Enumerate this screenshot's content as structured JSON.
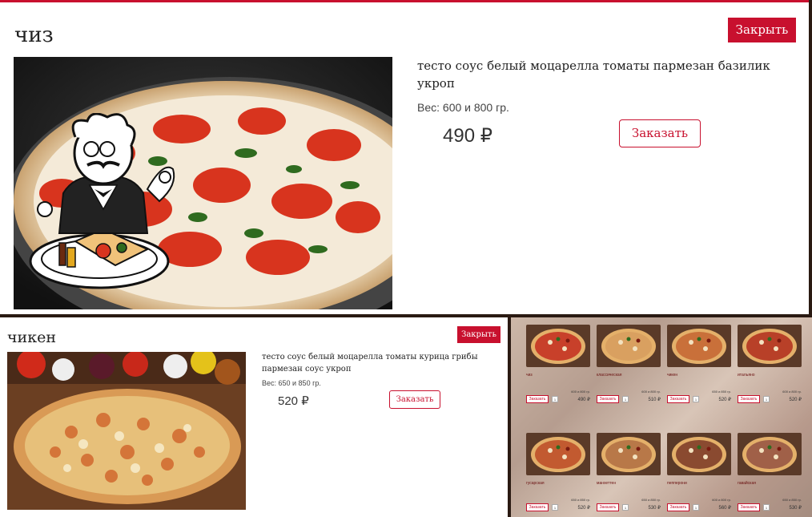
{
  "modal_top": {
    "title": "чиз",
    "close_label": "Закрыть",
    "description": "тесто соус белый моцарелла томаты пармезан базилик укроп",
    "weight": "Вес: 600 и 800 гр.",
    "price": "490 ₽",
    "order_label": "Заказать"
  },
  "modal_second": {
    "title": "чикен",
    "close_label": "Закрыть",
    "description": "тесто соус белый моцарелла томаты курица грибы пармезан соус укроп",
    "weight": "Вес: 650 и 850 гр.",
    "price": "520 ₽",
    "order_label": "Заказать"
  },
  "catalog": {
    "items": [
      {
        "name": "чиз",
        "weight": "600 и 800 гр.",
        "price": "490 ₽",
        "order": "Заказать",
        "qty": "1"
      },
      {
        "name": "классическая",
        "weight": "600 и 800 гр.",
        "price": "510 ₽",
        "order": "Заказать",
        "qty": "1"
      },
      {
        "name": "чикен",
        "weight": "650 и 850 гр.",
        "price": "520 ₽",
        "order": "Заказать",
        "qty": "1"
      },
      {
        "name": "итальяно",
        "weight": "600 и 800 гр.",
        "price": "520 ₽",
        "order": "Заказать",
        "qty": "1"
      },
      {
        "name": "гусарская",
        "weight": "650 и 850 гр.",
        "price": "520 ₽",
        "order": "Заказать",
        "qty": "1"
      },
      {
        "name": "манхеттен",
        "weight": "650 и 850 гр.",
        "price": "530 ₽",
        "order": "Заказать",
        "qty": "1"
      },
      {
        "name": "пепперони",
        "weight": "600 и 800 гр.",
        "price": "560 ₽",
        "order": "Заказать",
        "qty": "1"
      },
      {
        "name": "гавайская",
        "weight": "650 и 850 гр.",
        "price": "530 ₽",
        "order": "Заказать",
        "qty": "1"
      }
    ]
  },
  "colors": {
    "accent": "#c8102e",
    "text": "#222222",
    "background": "#ffffff"
  },
  "icons": [
    "chef-mascot-icon"
  ]
}
